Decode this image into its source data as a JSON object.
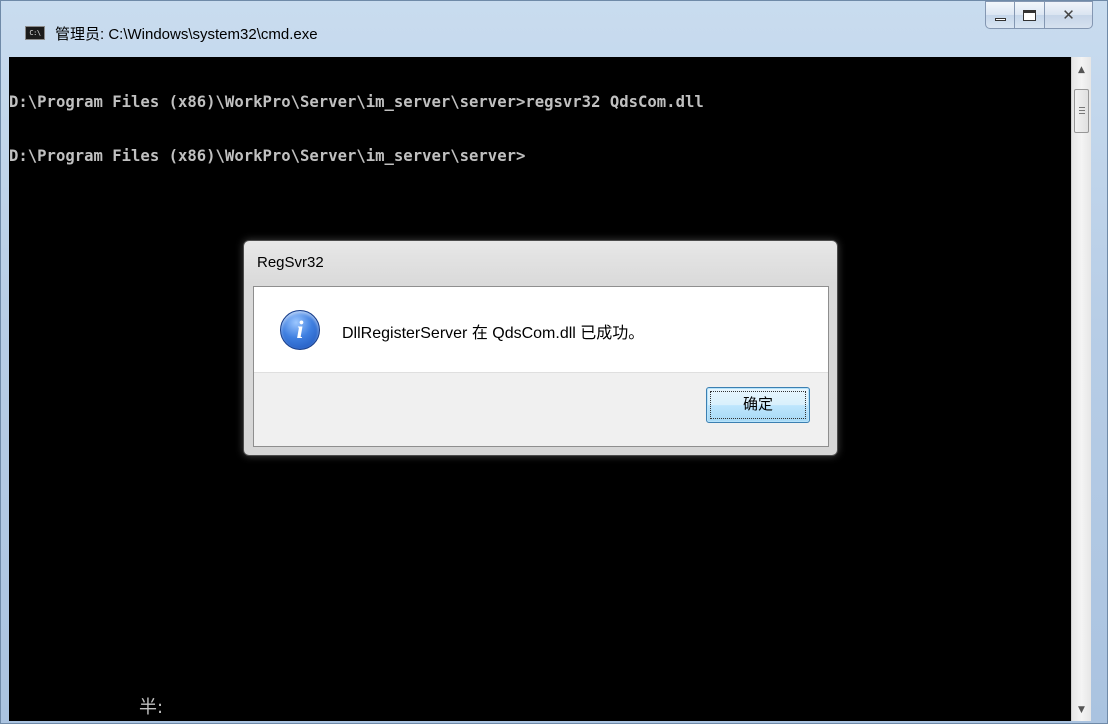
{
  "window": {
    "title": "管理员: C:\\Windows\\system32\\cmd.exe",
    "icon": "cmd-app-icon",
    "icon_text": "C:\\",
    "buttons": {
      "minimize": "minimize-icon",
      "maximize": "maximize-icon",
      "close": "close-icon"
    }
  },
  "console": {
    "lines": [
      "D:\\Program Files (x86)\\WorkPro\\Server\\im_server\\server>regsvr32 QdsCom.dll",
      "D:\\Program Files (x86)\\WorkPro\\Server\\im_server\\server>"
    ],
    "ime_status": "半:",
    "background": "#000000",
    "text_color": "#c0c0c0"
  },
  "dialog": {
    "title": "RegSvr32",
    "icon": "info-icon",
    "message": "DllRegisterServer 在 QdsCom.dll 已成功。",
    "ok_label": "确定"
  }
}
